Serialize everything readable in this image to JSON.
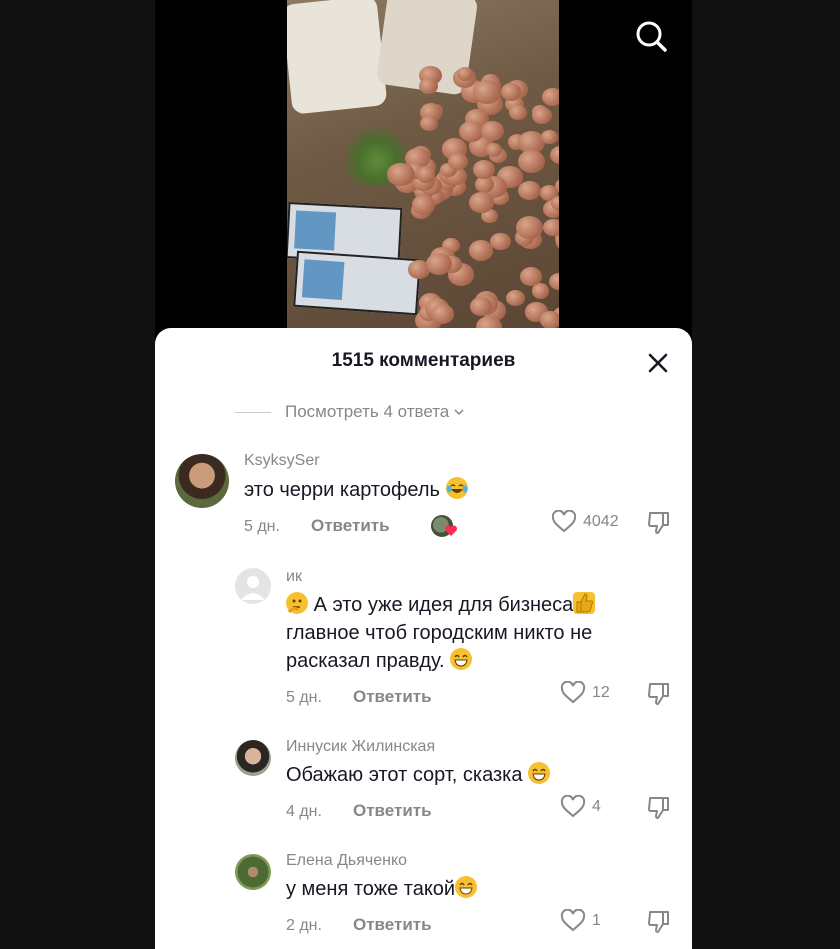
{
  "sheet": {
    "title": "1515 комментариев",
    "view_replies": "Посмотреть 4 ответа"
  },
  "comments": [
    {
      "username": "KsyksySer",
      "text": "это черри картофель",
      "emoji": "laughing-tears",
      "age": "5 дн.",
      "reply_label": "Ответить",
      "creator_liked": true,
      "likes": "4042"
    },
    {
      "username": "ик",
      "lines": [
        "А это уже идея для бизнеса",
        "главное чтоб городским никто не",
        "расказал правду."
      ],
      "emoji_start": "thinking-face",
      "emoji_mid": "thumbs-up",
      "emoji_end": "grinning-face",
      "age": "5 дн.",
      "reply_label": "Ответить",
      "likes": "12"
    },
    {
      "username": "Иннусик Жилинская",
      "text": "Обажаю этот сорт, сказка",
      "emoji": "grinning-face",
      "age": "4 дн.",
      "reply_label": "Ответить",
      "likes": "4"
    },
    {
      "username": "Елена Дьяченко",
      "text": "у меня тоже такой",
      "emoji": "grinning-face",
      "age": "2 дн.",
      "reply_label": "Ответить",
      "likes": "1"
    }
  ],
  "colors": {
    "text_primary": "#161823",
    "text_secondary": "#86878b",
    "like_heart": "#fe2c55"
  }
}
